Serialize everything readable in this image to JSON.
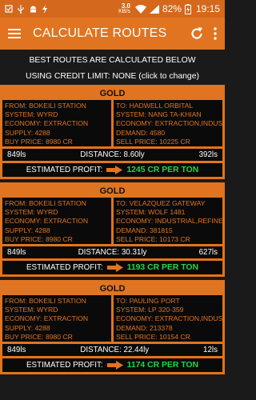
{
  "status": {
    "net_speed_value": "3.0",
    "net_speed_unit": "KB/s",
    "battery": "82%",
    "time": "19:15"
  },
  "app_bar": {
    "title": "CALCULATE ROUTES"
  },
  "info": {
    "line1": "BEST ROUTES ARE CALCULATED BELOW",
    "line2": "USING CREDIT LIMIT: NONE (click to change)"
  },
  "labels": {
    "system": "SYSTEM:",
    "economy": "ECONOMY:",
    "supply": "SUPPLY:",
    "demand": "DEMAND:",
    "buy_price": "BUY PRICE:",
    "sell_price": "SELL PRICE:",
    "from": "FROM:",
    "to": "TO:",
    "distance": "DISTANCE:",
    "estimated_profit": "ESTIMATED PROFIT:"
  },
  "routes": [
    {
      "commodity": "GOLD",
      "from": {
        "station": "BOKEILI STATION",
        "system": "WYRD",
        "economy": "EXTRACTION",
        "supply": "4288",
        "buy_price": "8980 CR"
      },
      "to": {
        "station": "HADWELL ORBITAL",
        "system": "NANG TA-KHIAN",
        "economy": "EXTRACTION,INDUST",
        "demand": "4580",
        "sell_price": "10225 CR"
      },
      "from_dist": "849ls",
      "distance": "8.60ly",
      "to_dist": "392ls",
      "profit": "1245 CR PER TON"
    },
    {
      "commodity": "GOLD",
      "from": {
        "station": "BOKEILI STATION",
        "system": "WYRD",
        "economy": "EXTRACTION",
        "supply": "4288",
        "buy_price": "8980 CR"
      },
      "to": {
        "station": "VELAZQUEZ GATEWAY",
        "system": "WOLF 1481",
        "economy": "INDUSTRIAL,REFINER",
        "demand": "381815",
        "sell_price": "10173 CR"
      },
      "from_dist": "849ls",
      "distance": "30.31ly",
      "to_dist": "627ls",
      "profit": "1193 CR PER TON"
    },
    {
      "commodity": "GOLD",
      "from": {
        "station": "BOKEILI STATION",
        "system": "WYRD",
        "economy": "EXTRACTION",
        "supply": "4288",
        "buy_price": "8980 CR"
      },
      "to": {
        "station": "PAULING PORT",
        "system": "LP 320-359",
        "economy": "EXTRACTION,INDUSTR",
        "demand": "213378",
        "sell_price": "10154 CR"
      },
      "from_dist": "849ls",
      "distance": "22.44ly",
      "to_dist": "12ls",
      "profit": "1174 CR PER TON"
    }
  ],
  "colors": {
    "accent": "#e07420",
    "status_bar": "#d4681c",
    "profit_green": "#22d648",
    "background": "#0a0a0a"
  }
}
